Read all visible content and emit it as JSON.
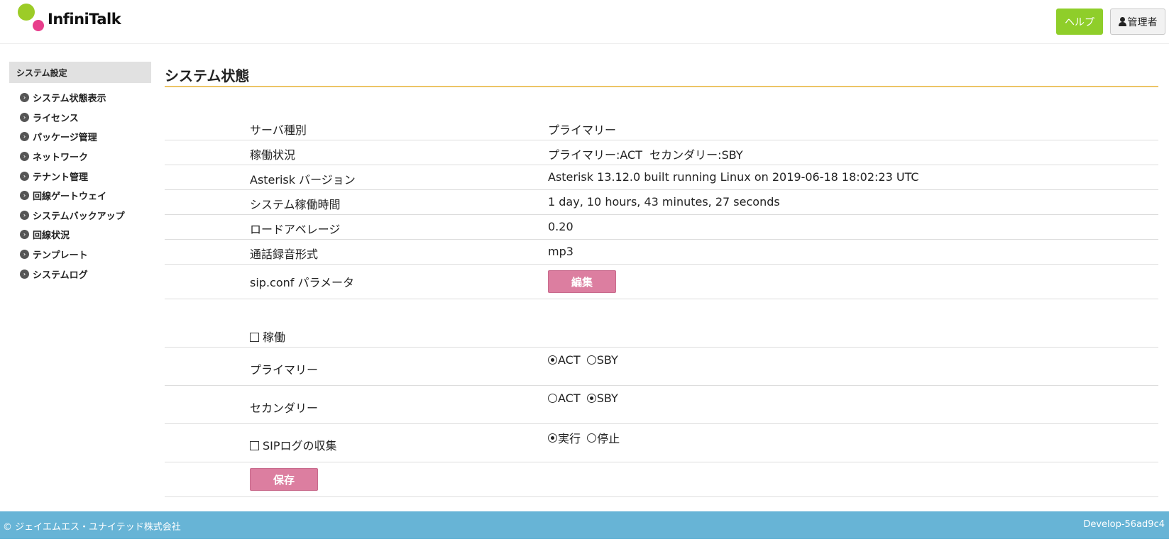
{
  "brand": {
    "logo_text": "InfiniTalk",
    "colors": {
      "green": "#9ccc27",
      "pink": "#e83e8c"
    }
  },
  "header": {
    "help_label": "ヘルプ",
    "admin_label": "管理者",
    "admin_icon": "user-icon"
  },
  "sidebar": {
    "title": "システム設定",
    "items": [
      {
        "label": "システム状態表示"
      },
      {
        "label": "ライセンス"
      },
      {
        "label": "パッケージ管理"
      },
      {
        "label": "ネットワーク"
      },
      {
        "label": "テナント管理"
      },
      {
        "label": "回線ゲートウェイ"
      },
      {
        "label": "システムバックアップ"
      },
      {
        "label": "回線状況"
      },
      {
        "label": "テンプレート"
      },
      {
        "label": "システムログ"
      }
    ]
  },
  "main": {
    "title": "システム状態",
    "info_rows": [
      {
        "label": "サーバ種別",
        "value": "プライマリー"
      },
      {
        "label": "稼働状況",
        "value": "プライマリー:ACT  セカンダリー:SBY"
      },
      {
        "label": "Asterisk バージョン",
        "value": "Asterisk 13.12.0 built running Linux on 2019-06-18 18:02:23 UTC"
      },
      {
        "label": "システム稼働時間",
        "value": "1 day, 10 hours, 43 minutes, 27 seconds"
      },
      {
        "label": "ロードアベレージ",
        "value": "0.20"
      },
      {
        "label": "通話録音形式",
        "value": "mp3"
      }
    ],
    "sip_conf": {
      "label": "sip.conf パラメータ",
      "button": "編集"
    },
    "operation": {
      "checkbox_label": "稼働",
      "checked": false,
      "primary": {
        "label": "プライマリー",
        "options": [
          "ACT",
          "SBY"
        ],
        "selected": "ACT"
      },
      "secondary": {
        "label": "セカンダリー",
        "options": [
          "ACT",
          "SBY"
        ],
        "selected": "SBY"
      }
    },
    "sip_log": {
      "label": "SIPログの収集",
      "checked": false,
      "options": [
        "実行",
        "停止"
      ],
      "selected": "実行"
    },
    "save_button": "保存"
  },
  "footer": {
    "copyright": "© ジェイエムエス・ユナイテッド株式会社",
    "version": "Develop-56ad9c4",
    "color": "#67b4d6"
  }
}
